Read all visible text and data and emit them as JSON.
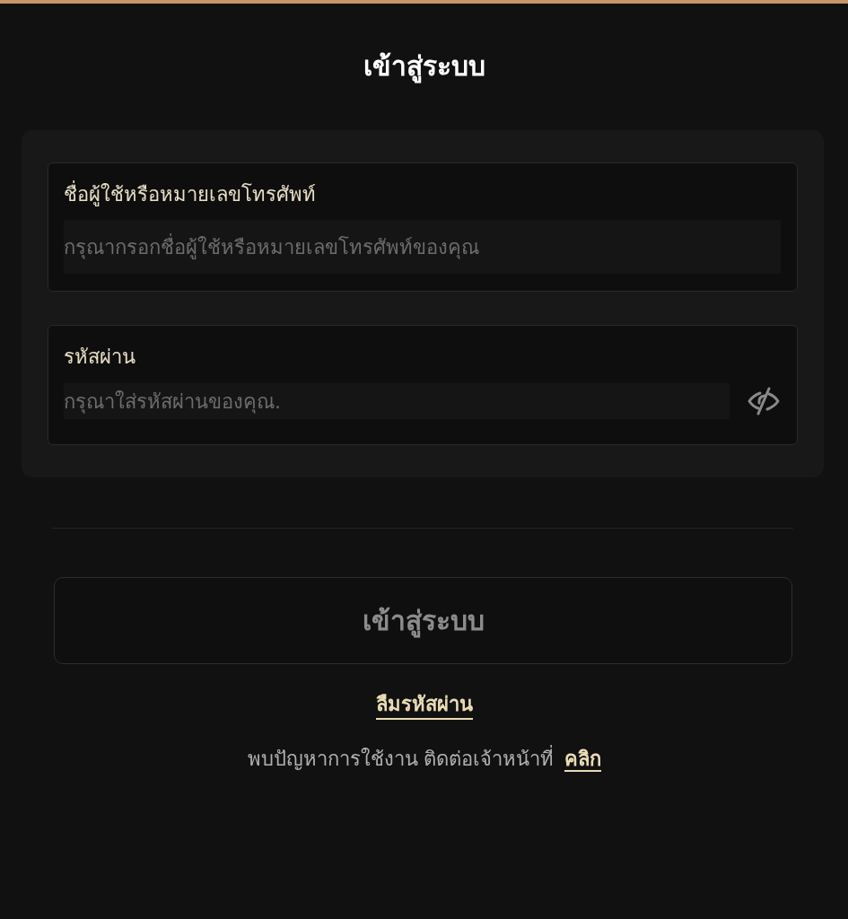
{
  "header": {
    "title": "เข้าสู่ระบบ"
  },
  "form": {
    "fields": [
      {
        "kind": "text",
        "label": "ชื่อผู้ใช้หรือหมายเลขโทรศัพท์",
        "placeholder": "กรุณากรอกชื่อผู้ใช้หรือหมายเลขโทรศัพท์ของคุณ"
      },
      {
        "kind": "password",
        "label": "รหัสผ่าน",
        "placeholder": "กรุณาใส่รหัสผ่านของคุณ.",
        "revealed": false
      }
    ]
  },
  "submit_button": {
    "label": "เข้าสู่ระบบ",
    "disabled": true
  },
  "forgot_password_link": "ลืมรหัสผ่าน",
  "help": {
    "text": "พบปัญหาการใช้งาน ติดต่อเจ้าหน้าที่",
    "link": "คลิก"
  }
}
